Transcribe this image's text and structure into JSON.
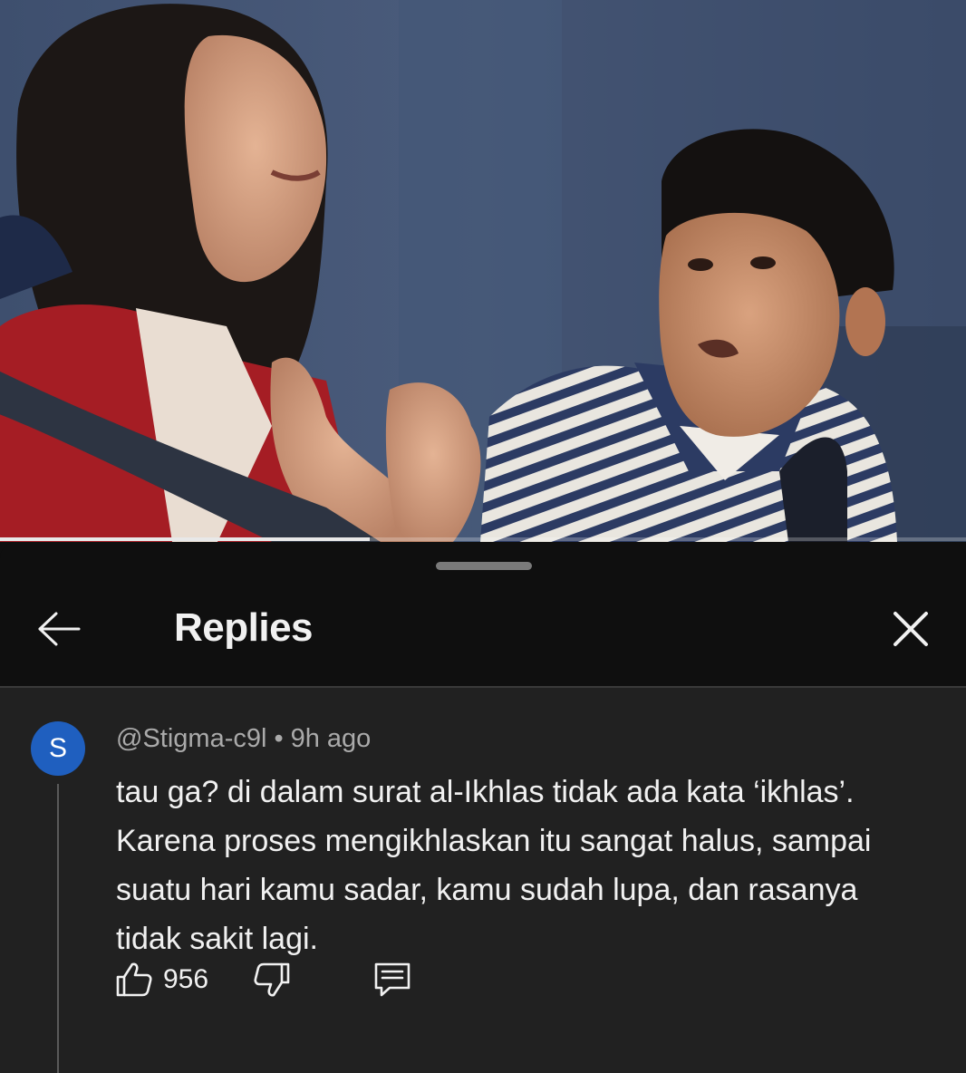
{
  "video": {
    "progress_fraction": 0.383
  },
  "sheet": {
    "title": "Replies",
    "back_icon": "arrow-left-icon",
    "close_icon": "close-icon"
  },
  "comment": {
    "avatar_letter": "S",
    "avatar_color": "#1f5fbf",
    "author": "@Stigma-c9l",
    "separator": "•",
    "time": "9h ago",
    "text": "tau ga? di dalam surat al-Ikhlas tidak ada kata ‘ikhlas’. Karena proses mengikhlaskan itu sangat halus, sampai suatu hari kamu sadar, kamu sudah lupa, dan rasanya tidak sakit lagi.",
    "like_count": "956",
    "like_icon": "thumbs-up-icon",
    "dislike_icon": "thumbs-down-icon",
    "reply_icon": "reply-comment-icon"
  }
}
